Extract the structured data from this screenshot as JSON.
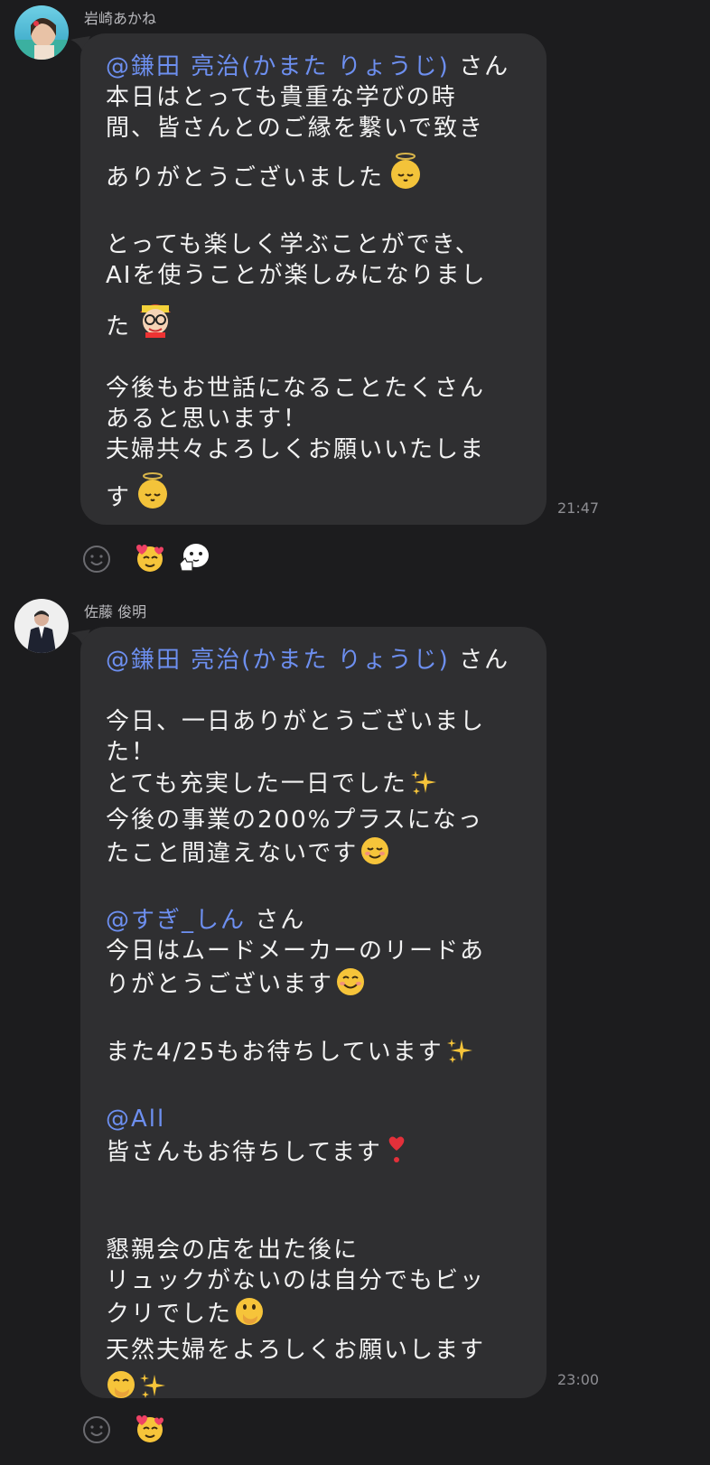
{
  "messages": [
    {
      "sender": "岩崎あかね",
      "time": "21:47",
      "mention": "@鎌田 亮治(かまた りょうじ)",
      "mention_suffix": " さん",
      "lines": [
        "本日はとっても貴重な学びの時",
        "間、皆さんとのご縁を繋いで致き",
        "ありがとうございました",
        "",
        "とっても楽しく学ぶことができ、",
        "AIを使うことが楽しみになりまし",
        "た",
        "",
        "今後もお世話になることたくさん",
        "あると思います！",
        "夫婦共々よろしくお願いいたしま",
        "す"
      ],
      "reactions": [
        "smiling-face-with-hearts-icon",
        "thumbs-up-sticker-icon"
      ]
    },
    {
      "sender": "佐藤 俊明",
      "time": "23:00",
      "mention": "@鎌田 亮治(かまた りょうじ)",
      "mention_suffix": " さん",
      "lines": [
        "今日、一日ありがとうございまし",
        "た！",
        "とても充実した一日でした",
        "今後の事業の200%プラスになっ",
        "たこと間違えないです"
      ],
      "mention2": "@すぎ_しん",
      "mention2_suffix": " さん",
      "lines2": [
        "今日はムードメーカーのリードあ",
        "りがとうございます",
        "",
        "また4/25もお待ちしています"
      ],
      "mention3": "@All",
      "lines3": [
        "皆さんもお待ちしてます",
        "",
        "",
        "懇親会の店を出た後に",
        "リュックがないのは自分でもビッ",
        "クリでした",
        "天然夫婦をよろしくお願いします"
      ],
      "reactions": [
        "smiling-face-with-hearts-icon"
      ]
    }
  ],
  "colors": {
    "background": "#1c1c1e",
    "bubble": "#2f2f31",
    "mention": "#6d8ff0",
    "text": "#f2f2f2",
    "meta": "#8e8e93"
  }
}
